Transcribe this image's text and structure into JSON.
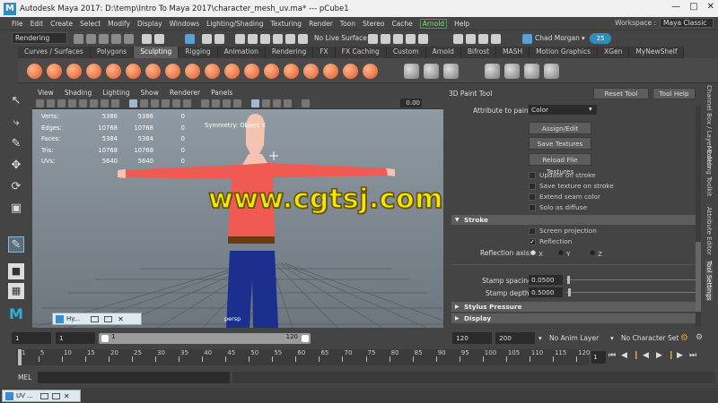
{
  "window": {
    "title": "Autodesk Maya 2017: D:\\temp\\Intro To Maya 2017\\character_mesh_uv.ma* --- pCube1",
    "logo": "M"
  },
  "menubar": {
    "items": [
      "File",
      "Edit",
      "Create",
      "Select",
      "Modify",
      "Display",
      "Windows",
      "Lighting/Shading",
      "Texturing",
      "Render",
      "Toon",
      "Stereo",
      "Cache",
      "Arnold",
      "Help"
    ]
  },
  "workspace": {
    "label": "Workspace :",
    "value": "Maya Classic"
  },
  "statusline": {
    "menuset": "Rendering",
    "live_surface": "No Live Surface",
    "user": "Chad Morgan",
    "notifications": "25"
  },
  "shelf": {
    "tabs": [
      "Curves / Surfaces",
      "Polygons",
      "Sculpting",
      "Rigging",
      "Animation",
      "Rendering",
      "FX",
      "FX Caching",
      "Custom",
      "Arnold",
      "Bifrost",
      "MASH",
      "Motion Graphics",
      "XGen",
      "MyNewShelf"
    ],
    "active_tab": "Sculpting"
  },
  "viewport": {
    "menu": [
      "View",
      "Shading",
      "Lighting",
      "Show",
      "Renderer",
      "Panels"
    ],
    "exposure": "0.00",
    "hud": [
      {
        "label": "Verts:",
        "v1": "5386",
        "v2": "5386",
        "v3": "0"
      },
      {
        "label": "Edges:",
        "v1": "10768",
        "v2": "10768",
        "v3": "0"
      },
      {
        "label": "Faces:",
        "v1": "5384",
        "v2": "5384",
        "v3": "0"
      },
      {
        "label": "Tris:",
        "v1": "10768",
        "v2": "10768",
        "v3": "0"
      },
      {
        "label": "UVs:",
        "v1": "5640",
        "v2": "5640",
        "v3": "0"
      }
    ],
    "symmetry": "Symmetry: Object X",
    "camera": "persp",
    "watermark": "www.cgtsj.com"
  },
  "hypershade": {
    "label": "Hy..."
  },
  "tool_panel": {
    "title": "3D Paint Tool",
    "reset": "Reset Tool",
    "help": "Tool Help",
    "attribute_label": "Attribute to paint:",
    "attribute_value": "Color",
    "buttons": [
      "Assign/Edit Textures",
      "Save Textures",
      "Reload File Textures"
    ],
    "options": [
      {
        "label": "Update on stroke",
        "checked": false
      },
      {
        "label": "Save texture on stroke",
        "checked": false
      },
      {
        "label": "Extend seam color",
        "checked": false
      },
      {
        "label": "Solo as diffuse",
        "checked": false
      }
    ],
    "stroke_section": "Stroke",
    "screen_projection": "Screen projection",
    "reflection": "Reflection",
    "reflection_axis_label": "Reflection axis:",
    "axes": [
      "X",
      "Y",
      "Z"
    ],
    "stamp_spacing_label": "Stamp spacing:",
    "stamp_spacing": "0.0500",
    "stamp_depth_label": "Stamp depth:",
    "stamp_depth": "0.5000",
    "stylus_section": "Stylus Pressure",
    "display_section": "Display"
  },
  "side_tabs": [
    "Channel Box / Layer Editor",
    "Modeling Toolkit",
    "Attribute Editor",
    "Tool Settings"
  ],
  "time": {
    "start": "1",
    "range_start": "1",
    "range_start_inner": "1",
    "range_end_inner": "120",
    "range_end": "120",
    "end": "200",
    "anim_layer": "No Anim Layer",
    "character_set": "No Character Set",
    "current_frame": "1",
    "ticks": [
      "1",
      "5",
      "10",
      "15",
      "20",
      "25",
      "30",
      "35",
      "40",
      "45",
      "50",
      "55",
      "60",
      "65",
      "70",
      "75",
      "80",
      "85",
      "90",
      "95",
      "100",
      "105",
      "110",
      "115",
      "120"
    ]
  },
  "command": {
    "label": "MEL"
  },
  "uv_window": {
    "label": "UV ..."
  }
}
